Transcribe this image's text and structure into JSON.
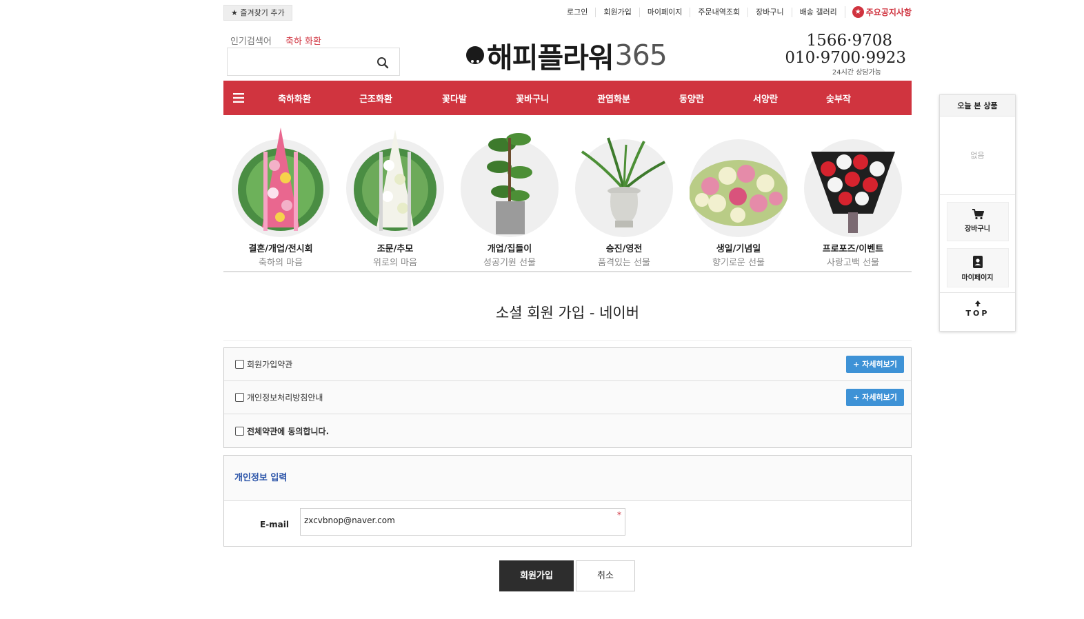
{
  "top_bar": {
    "favorite_label": "★ 즐겨찾기 추가",
    "links": [
      "로그인",
      "회원가입",
      "마이페이지",
      "주문내역조회",
      "장바구니",
      "배송 갤러리"
    ],
    "notice_label": "주요공지사항"
  },
  "header": {
    "popular_label": "인기검색어",
    "popular_keyword": "축하 화환",
    "search_value": "",
    "logo_text": "해피플라워",
    "logo_number": "365",
    "phone_1": "1566·9708",
    "phone_2": "010·9700·9923",
    "phone_note": "24시간 상담가능"
  },
  "nav": {
    "items": [
      "축하화환",
      "근조화환",
      "꽃다발",
      "꽃바구니",
      "관엽화분",
      "동양란",
      "서양란",
      "숯부작"
    ]
  },
  "categories": [
    {
      "title": "결혼/개업/전시회",
      "subtitle": "축하의 마음"
    },
    {
      "title": "조문/추모",
      "subtitle": "위로의 마음"
    },
    {
      "title": "개업/집들이",
      "subtitle": "성공기원 선물"
    },
    {
      "title": "승진/영전",
      "subtitle": "품격있는 선물"
    },
    {
      "title": "생일/기념일",
      "subtitle": "향기로운 선물"
    },
    {
      "title": "프로포즈/이벤트",
      "subtitle": "사랑고백 선물"
    }
  ],
  "page_title": "소셜 회원 가입 - 네이버",
  "terms": {
    "row1": "회원가입약관",
    "row2": "개인정보처리방침안내",
    "row3": "전체약관에 동의합니다.",
    "more_label": "+  자세히보기"
  },
  "info": {
    "heading": "개인정보 입력",
    "email_label": "E-mail",
    "email_value": "zxcvbnop@naver.com",
    "required_mark": "*"
  },
  "buttons": {
    "join": "회원가입",
    "cancel": "취소"
  },
  "side_panel": {
    "title": "오늘 본 상품",
    "empty": "없음",
    "cart": "장바구니",
    "mypage": "마이페이지",
    "top": "TOP"
  },
  "colors": {
    "brand_red": "#d0343f",
    "button_blue": "#3e92d6",
    "heading_blue": "#2a53a8"
  }
}
